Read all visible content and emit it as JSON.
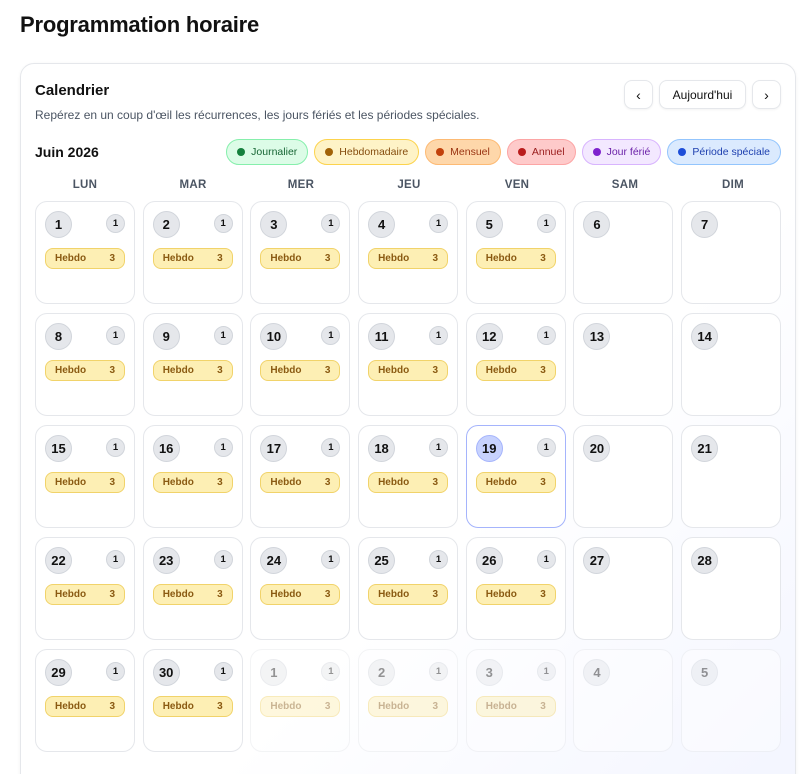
{
  "page": {
    "title": "Programmation horaire"
  },
  "calendar": {
    "title": "Calendrier",
    "subtitle": "Repérez en un coup d'œil les récurrences, les jours fériés et les périodes spéciales.",
    "month_label": "Juin 2026",
    "nav": {
      "prev": "‹",
      "today": "Aujourd'hui",
      "next": "›"
    },
    "legend": [
      {
        "label": "Journalier",
        "dot": "#15803d",
        "bg": "#dcfce7",
        "border": "#86efac",
        "text": "#166534"
      },
      {
        "label": "Hebdomadaire",
        "dot": "#a16207",
        "bg": "#fef3c7",
        "border": "#fcd34d",
        "text": "#854d0e"
      },
      {
        "label": "Mensuel",
        "dot": "#c2410c",
        "bg": "#fed7aa",
        "border": "#fdba74",
        "text": "#9a3412"
      },
      {
        "label": "Annuel",
        "dot": "#b91c1c",
        "bg": "#fecaca",
        "border": "#fca5a5",
        "text": "#991b1b"
      },
      {
        "label": "Jour férié",
        "dot": "#7e22ce",
        "bg": "#f3e8ff",
        "border": "#d8b4fe",
        "text": "#6b21a8"
      },
      {
        "label": "Période spéciale",
        "dot": "#1d4ed8",
        "bg": "#dbeafe",
        "border": "#93c5fd",
        "text": "#1e40af"
      }
    ],
    "weekdays": [
      "LUN",
      "MAR",
      "MER",
      "JEU",
      "VEN",
      "SAM",
      "DIM"
    ],
    "days": [
      {
        "day": "1",
        "count": "1",
        "event": "Hebdo",
        "event_count": "3"
      },
      {
        "day": "2",
        "count": "1",
        "event": "Hebdo",
        "event_count": "3"
      },
      {
        "day": "3",
        "count": "1",
        "event": "Hebdo",
        "event_count": "3"
      },
      {
        "day": "4",
        "count": "1",
        "event": "Hebdo",
        "event_count": "3"
      },
      {
        "day": "5",
        "count": "1",
        "event": "Hebdo",
        "event_count": "3"
      },
      {
        "day": "6"
      },
      {
        "day": "7"
      },
      {
        "day": "8",
        "count": "1",
        "event": "Hebdo",
        "event_count": "3"
      },
      {
        "day": "9",
        "count": "1",
        "event": "Hebdo",
        "event_count": "3"
      },
      {
        "day": "10",
        "count": "1",
        "event": "Hebdo",
        "event_count": "3"
      },
      {
        "day": "11",
        "count": "1",
        "event": "Hebdo",
        "event_count": "3"
      },
      {
        "day": "12",
        "count": "1",
        "event": "Hebdo",
        "event_count": "3"
      },
      {
        "day": "13"
      },
      {
        "day": "14"
      },
      {
        "day": "15",
        "count": "1",
        "event": "Hebdo",
        "event_count": "3"
      },
      {
        "day": "16",
        "count": "1",
        "event": "Hebdo",
        "event_count": "3"
      },
      {
        "day": "17",
        "count": "1",
        "event": "Hebdo",
        "event_count": "3"
      },
      {
        "day": "18",
        "count": "1",
        "event": "Hebdo",
        "event_count": "3"
      },
      {
        "day": "19",
        "count": "1",
        "event": "Hebdo",
        "event_count": "3",
        "today": true
      },
      {
        "day": "20"
      },
      {
        "day": "21"
      },
      {
        "day": "22",
        "count": "1",
        "event": "Hebdo",
        "event_count": "3"
      },
      {
        "day": "23",
        "count": "1",
        "event": "Hebdo",
        "event_count": "3"
      },
      {
        "day": "24",
        "count": "1",
        "event": "Hebdo",
        "event_count": "3"
      },
      {
        "day": "25",
        "count": "1",
        "event": "Hebdo",
        "event_count": "3"
      },
      {
        "day": "26",
        "count": "1",
        "event": "Hebdo",
        "event_count": "3"
      },
      {
        "day": "27"
      },
      {
        "day": "28"
      },
      {
        "day": "29",
        "count": "1",
        "event": "Hebdo",
        "event_count": "3"
      },
      {
        "day": "30",
        "count": "1",
        "event": "Hebdo",
        "event_count": "3"
      },
      {
        "day": "1",
        "count": "1",
        "event": "Hebdo",
        "event_count": "3",
        "outside": true
      },
      {
        "day": "2",
        "count": "1",
        "event": "Hebdo",
        "event_count": "3",
        "outside": true
      },
      {
        "day": "3",
        "count": "1",
        "event": "Hebdo",
        "event_count": "3",
        "outside": true
      },
      {
        "day": "4",
        "outside": true
      },
      {
        "day": "5",
        "outside": true
      }
    ]
  }
}
